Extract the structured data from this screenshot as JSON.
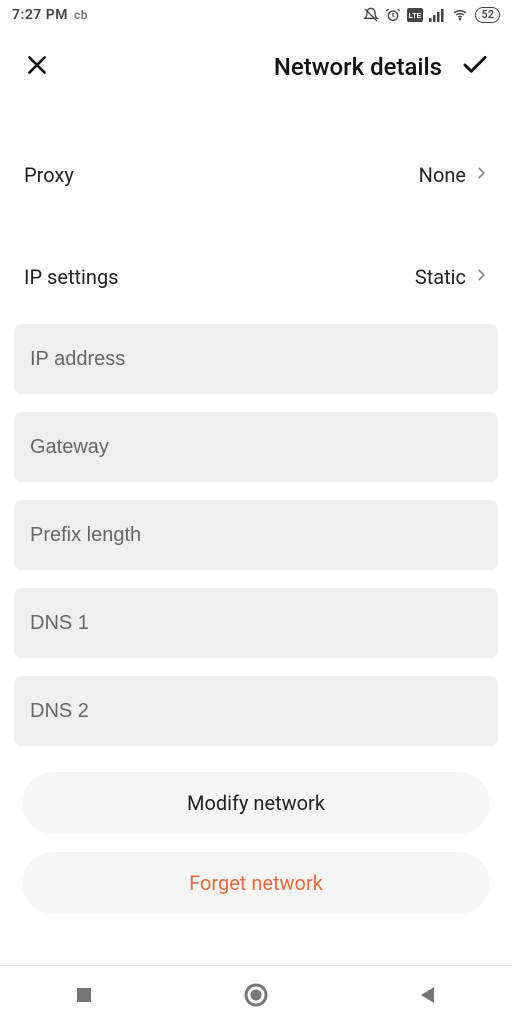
{
  "statusbar": {
    "time": "7:27 PM",
    "cb": "cb",
    "battery": "52"
  },
  "header": {
    "title": "Network details"
  },
  "rows": {
    "proxy_label": "Proxy",
    "proxy_value": "None",
    "ip_settings_label": "IP settings",
    "ip_settings_value": "Static"
  },
  "fields": {
    "ip_address": "IP address",
    "gateway": "Gateway",
    "prefix_length": "Prefix length",
    "dns1": "DNS 1",
    "dns2": "DNS 2"
  },
  "buttons": {
    "modify": "Modify network",
    "forget": "Forget network"
  }
}
